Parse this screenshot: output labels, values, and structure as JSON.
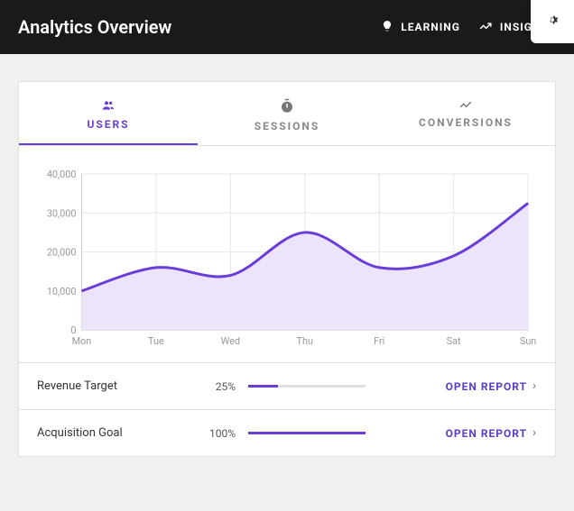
{
  "header": {
    "title": "Analytics Overview",
    "nav": {
      "learning": "LEARNING",
      "insights": "INSIGHTS"
    }
  },
  "tabs": {
    "users": "USERS",
    "sessions": "SESSIONS",
    "conversions": "CONVERSIONS"
  },
  "chart_data": {
    "type": "area",
    "title": "",
    "xlabel": "",
    "ylabel": "",
    "ylim": [
      0,
      40000
    ],
    "yticks": [
      "0",
      "10,000",
      "20,000",
      "30,000",
      "40,000"
    ],
    "categories": [
      "Mon",
      "Tue",
      "Wed",
      "Thu",
      "Fri",
      "Sat",
      "Sun"
    ],
    "values": [
      10000,
      16000,
      14000,
      25000,
      16000,
      19000,
      32500
    ]
  },
  "kpis": [
    {
      "label": "Revenue Target",
      "pct_text": "25%",
      "pct": 25,
      "link": "OPEN REPORT"
    },
    {
      "label": "Acquisition Goal",
      "pct_text": "100%",
      "pct": 100,
      "link": "OPEN REPORT"
    }
  ],
  "colors": {
    "accent": "#6a3dd9",
    "area": "#ece4fb"
  }
}
